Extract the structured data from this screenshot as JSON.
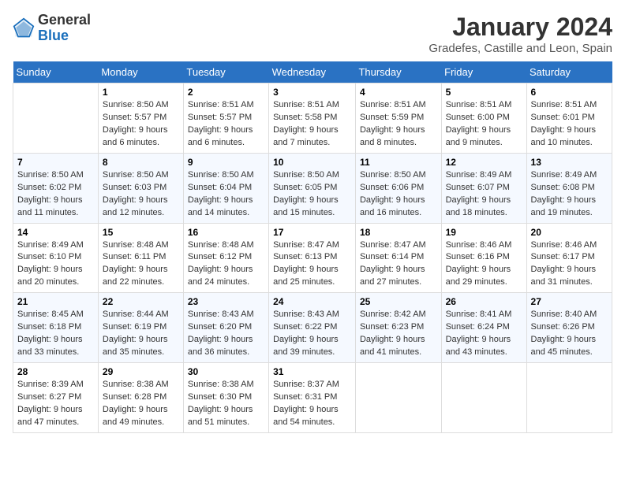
{
  "logo": {
    "general": "General",
    "blue": "Blue"
  },
  "title": "January 2024",
  "subtitle": "Gradefes, Castille and Leon, Spain",
  "days_header": [
    "Sunday",
    "Monday",
    "Tuesday",
    "Wednesday",
    "Thursday",
    "Friday",
    "Saturday"
  ],
  "weeks": [
    [
      {
        "num": "",
        "info": ""
      },
      {
        "num": "1",
        "info": "Sunrise: 8:50 AM\nSunset: 5:57 PM\nDaylight: 9 hours\nand 6 minutes."
      },
      {
        "num": "2",
        "info": "Sunrise: 8:51 AM\nSunset: 5:57 PM\nDaylight: 9 hours\nand 6 minutes."
      },
      {
        "num": "3",
        "info": "Sunrise: 8:51 AM\nSunset: 5:58 PM\nDaylight: 9 hours\nand 7 minutes."
      },
      {
        "num": "4",
        "info": "Sunrise: 8:51 AM\nSunset: 5:59 PM\nDaylight: 9 hours\nand 8 minutes."
      },
      {
        "num": "5",
        "info": "Sunrise: 8:51 AM\nSunset: 6:00 PM\nDaylight: 9 hours\nand 9 minutes."
      },
      {
        "num": "6",
        "info": "Sunrise: 8:51 AM\nSunset: 6:01 PM\nDaylight: 9 hours\nand 10 minutes."
      }
    ],
    [
      {
        "num": "7",
        "info": "Sunrise: 8:50 AM\nSunset: 6:02 PM\nDaylight: 9 hours\nand 11 minutes."
      },
      {
        "num": "8",
        "info": "Sunrise: 8:50 AM\nSunset: 6:03 PM\nDaylight: 9 hours\nand 12 minutes."
      },
      {
        "num": "9",
        "info": "Sunrise: 8:50 AM\nSunset: 6:04 PM\nDaylight: 9 hours\nand 14 minutes."
      },
      {
        "num": "10",
        "info": "Sunrise: 8:50 AM\nSunset: 6:05 PM\nDaylight: 9 hours\nand 15 minutes."
      },
      {
        "num": "11",
        "info": "Sunrise: 8:50 AM\nSunset: 6:06 PM\nDaylight: 9 hours\nand 16 minutes."
      },
      {
        "num": "12",
        "info": "Sunrise: 8:49 AM\nSunset: 6:07 PM\nDaylight: 9 hours\nand 18 minutes."
      },
      {
        "num": "13",
        "info": "Sunrise: 8:49 AM\nSunset: 6:08 PM\nDaylight: 9 hours\nand 19 minutes."
      }
    ],
    [
      {
        "num": "14",
        "info": "Sunrise: 8:49 AM\nSunset: 6:10 PM\nDaylight: 9 hours\nand 20 minutes."
      },
      {
        "num": "15",
        "info": "Sunrise: 8:48 AM\nSunset: 6:11 PM\nDaylight: 9 hours\nand 22 minutes."
      },
      {
        "num": "16",
        "info": "Sunrise: 8:48 AM\nSunset: 6:12 PM\nDaylight: 9 hours\nand 24 minutes."
      },
      {
        "num": "17",
        "info": "Sunrise: 8:47 AM\nSunset: 6:13 PM\nDaylight: 9 hours\nand 25 minutes."
      },
      {
        "num": "18",
        "info": "Sunrise: 8:47 AM\nSunset: 6:14 PM\nDaylight: 9 hours\nand 27 minutes."
      },
      {
        "num": "19",
        "info": "Sunrise: 8:46 AM\nSunset: 6:16 PM\nDaylight: 9 hours\nand 29 minutes."
      },
      {
        "num": "20",
        "info": "Sunrise: 8:46 AM\nSunset: 6:17 PM\nDaylight: 9 hours\nand 31 minutes."
      }
    ],
    [
      {
        "num": "21",
        "info": "Sunrise: 8:45 AM\nSunset: 6:18 PM\nDaylight: 9 hours\nand 33 minutes."
      },
      {
        "num": "22",
        "info": "Sunrise: 8:44 AM\nSunset: 6:19 PM\nDaylight: 9 hours\nand 35 minutes."
      },
      {
        "num": "23",
        "info": "Sunrise: 8:43 AM\nSunset: 6:20 PM\nDaylight: 9 hours\nand 36 minutes."
      },
      {
        "num": "24",
        "info": "Sunrise: 8:43 AM\nSunset: 6:22 PM\nDaylight: 9 hours\nand 39 minutes."
      },
      {
        "num": "25",
        "info": "Sunrise: 8:42 AM\nSunset: 6:23 PM\nDaylight: 9 hours\nand 41 minutes."
      },
      {
        "num": "26",
        "info": "Sunrise: 8:41 AM\nSunset: 6:24 PM\nDaylight: 9 hours\nand 43 minutes."
      },
      {
        "num": "27",
        "info": "Sunrise: 8:40 AM\nSunset: 6:26 PM\nDaylight: 9 hours\nand 45 minutes."
      }
    ],
    [
      {
        "num": "28",
        "info": "Sunrise: 8:39 AM\nSunset: 6:27 PM\nDaylight: 9 hours\nand 47 minutes."
      },
      {
        "num": "29",
        "info": "Sunrise: 8:38 AM\nSunset: 6:28 PM\nDaylight: 9 hours\nand 49 minutes."
      },
      {
        "num": "30",
        "info": "Sunrise: 8:38 AM\nSunset: 6:30 PM\nDaylight: 9 hours\nand 51 minutes."
      },
      {
        "num": "31",
        "info": "Sunrise: 8:37 AM\nSunset: 6:31 PM\nDaylight: 9 hours\nand 54 minutes."
      },
      {
        "num": "",
        "info": ""
      },
      {
        "num": "",
        "info": ""
      },
      {
        "num": "",
        "info": ""
      }
    ]
  ]
}
